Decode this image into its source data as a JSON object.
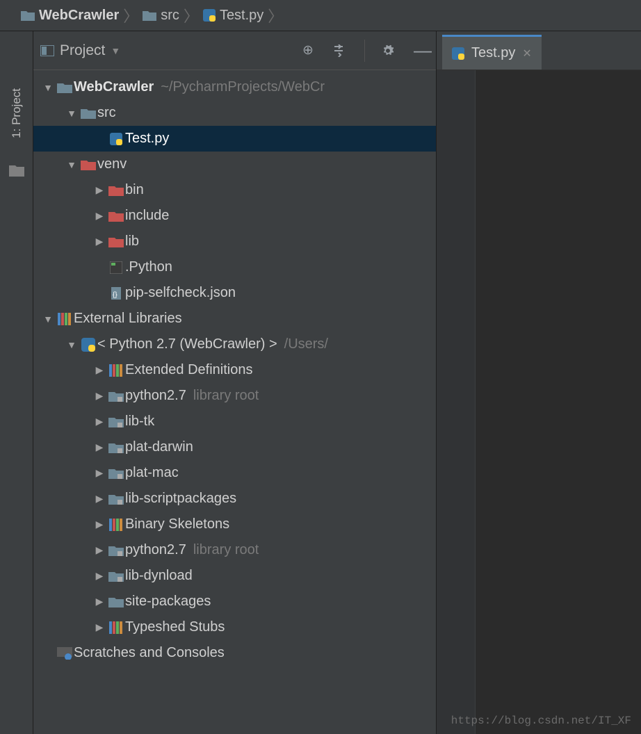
{
  "breadcrumb": {
    "project": "WebCrawler",
    "folder": "src",
    "file": "Test.py"
  },
  "tool_window": {
    "title": "Project",
    "actions": {
      "target": "⊕",
      "autoscroll": "≡",
      "settings": "⚙",
      "minimize": "—"
    }
  },
  "tree": {
    "root": {
      "name": "WebCrawler",
      "path": "~/PycharmProjects/WebCr"
    },
    "src": {
      "name": "src"
    },
    "testpy": {
      "name": "Test.py"
    },
    "venv": {
      "name": "venv"
    },
    "venv_children": {
      "bin": "bin",
      "include": "include",
      "lib": "lib",
      "python": ".Python",
      "pipself": "pip-selfcheck.json"
    },
    "ext_lib": {
      "name": "External Libraries"
    },
    "python_env": {
      "name": "< Python 2.7 (WebCrawler) >",
      "path": "/Users/"
    },
    "env_children": {
      "extdef": "Extended Definitions",
      "py27a": "python2.7",
      "py27a_hint": "library root",
      "libtk": "lib-tk",
      "platdarwin": "plat-darwin",
      "platmac": "plat-mac",
      "libscript": "lib-scriptpackages",
      "binskel": "Binary Skeletons",
      "py27b": "python2.7",
      "py27b_hint": "library root",
      "libdyn": "lib-dynload",
      "sitepkg": "site-packages",
      "typeshed": "Typeshed Stubs"
    },
    "scratches": "Scratches and Consoles"
  },
  "editor": {
    "tab": "Test.py"
  },
  "sidebar": {
    "tab_label": "1: Project"
  },
  "watermark": "https://blog.csdn.net/IT_XF"
}
